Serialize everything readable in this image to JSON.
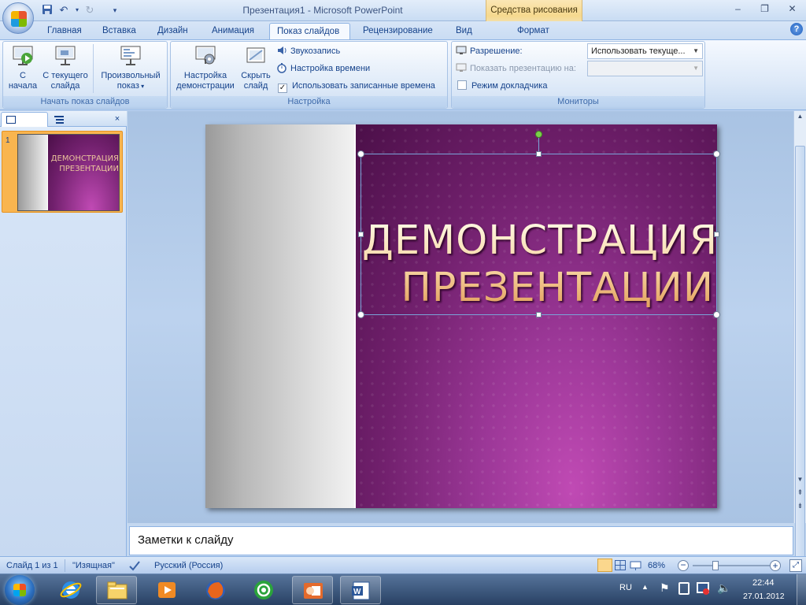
{
  "window": {
    "title": "Презентация1 - Microsoft PowerPoint",
    "contextual_tab_group": "Средства рисования"
  },
  "tabs": [
    {
      "label": "Главная"
    },
    {
      "label": "Вставка"
    },
    {
      "label": "Дизайн"
    },
    {
      "label": "Анимация"
    },
    {
      "label": "Показ слайдов",
      "active": true
    },
    {
      "label": "Рецензирование"
    },
    {
      "label": "Вид"
    },
    {
      "label": "Формат"
    }
  ],
  "ribbon": {
    "start_group": {
      "label": "Начать показ слайдов",
      "from_start": [
        "С",
        "начала"
      ],
      "from_current": [
        "С текущего",
        "слайда"
      ],
      "custom": [
        "Произвольный",
        "показ"
      ]
    },
    "setup_group": {
      "label": "Настройка",
      "setup_show": [
        "Настройка",
        "демонстрации"
      ],
      "hide_slide": [
        "Скрыть",
        "слайд"
      ],
      "record_narration": "Звукозапись",
      "rehearse_timings": "Настройка времени",
      "use_timings": "Использовать записанные времена",
      "use_timings_checked": true
    },
    "monitors_group": {
      "label": "Мониторы",
      "resolution_label": "Разрешение:",
      "resolution_value": "Использовать текуще...",
      "show_on_label": "Показать презентацию на:",
      "show_on_value": "",
      "presenter_view": "Режим докладчика",
      "presenter_view_checked": false
    }
  },
  "slides_pane": {
    "slide_number": "1",
    "thumbnail_title": "ДЕМОНСТРАЦИЯ ПРЕЗЕНТАЦИИ"
  },
  "slide": {
    "title_line1": "ДЕМОНСТРАЦИЯ",
    "title_line2": "ПРЕЗЕНТАЦИИ"
  },
  "notes": {
    "placeholder": "Заметки к слайду"
  },
  "status_bar": {
    "slide_info": "Слайд 1 из 1",
    "theme": "\"Изящная\"",
    "language": "Русский (Россия)",
    "zoom": "68%",
    "zoom_level": 0.68
  },
  "taskbar": {
    "language": "RU",
    "time": "22:44",
    "date": "27.01.2012"
  },
  "colors": {
    "slide_purple": "#71206d",
    "title_gradient_top": "#fffbe8",
    "title_gradient_bottom": "#e09a55",
    "ribbon_blue": "#15428b",
    "contextual_orange": "#f6d98e"
  }
}
